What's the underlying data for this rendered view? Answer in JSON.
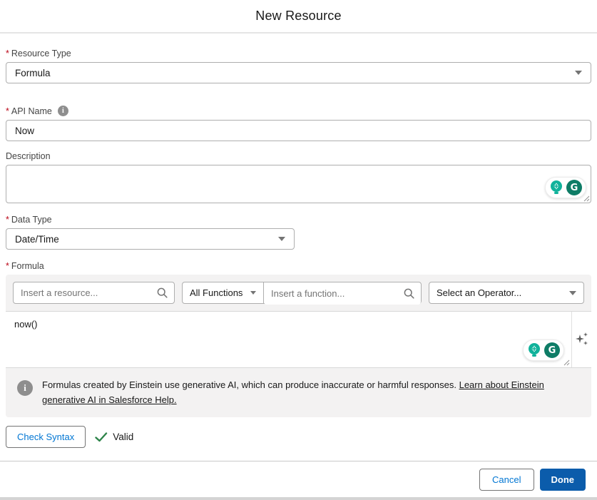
{
  "modal": {
    "title": "New Resource"
  },
  "fields": {
    "resource_type": {
      "label": "Resource Type",
      "required": "*",
      "value": "Formula"
    },
    "api_name": {
      "label": "API Name",
      "required": "*",
      "value": "Now"
    },
    "description": {
      "label": "Description",
      "value": ""
    },
    "data_type": {
      "label": "Data Type",
      "required": "*",
      "value": "Date/Time"
    },
    "formula": {
      "label": "Formula",
      "required": "*",
      "value": "now()"
    }
  },
  "formula_toolbar": {
    "resource_search": {
      "placeholder": "Insert a resource..."
    },
    "function_filter": {
      "value": "All Functions"
    },
    "function_search": {
      "placeholder": "Insert a function..."
    },
    "operator_select": {
      "value": "Select an Operator..."
    }
  },
  "einstein_banner": {
    "text": "Formulas created by Einstein use generative AI, which can produce inaccurate or harmful responses. ",
    "link": "Learn about Einstein generative AI in Salesforce Help."
  },
  "syntax_check": {
    "button": "Check Syntax",
    "status": "Valid"
  },
  "footer": {
    "cancel": "Cancel",
    "done": "Done"
  },
  "icons": {
    "info_glyph": "i",
    "grammarly_g_glyph": "G"
  },
  "colors": {
    "accent_blue": "#0176d3",
    "done_button_bg": "#0b5cab",
    "valid_green": "#2e844a",
    "required_red": "#ba0517",
    "grammarly_teal": "#10b29b",
    "grammarly_green": "#0e7c66",
    "panel_gray": "#f3f2f2"
  }
}
